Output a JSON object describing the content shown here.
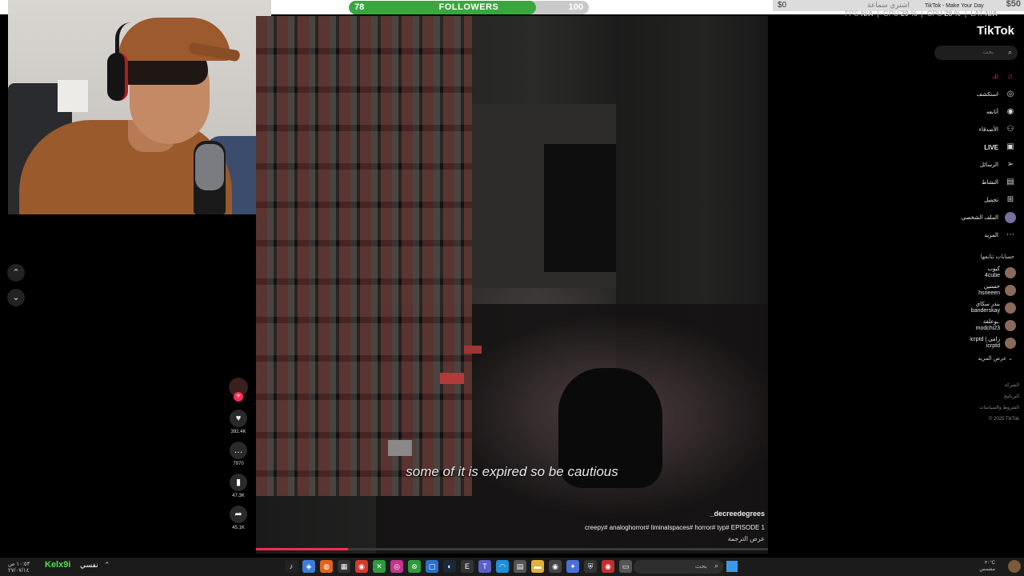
{
  "overlay": {
    "followers_label": "FOLLOWERS",
    "followers_current": "78",
    "followers_goal": "100",
    "followers_progress": 0.78,
    "donation_amount": "$0",
    "donation_text": "اشتري سماعة",
    "donation_goal": "$50",
    "window_title": "TikTok - Make Your Day"
  },
  "stats": {
    "fps_label": "FPS",
    "fps_value": "N/A",
    "gpu_label": "GPU",
    "gpu_value": "29 %",
    "cpu_label": "CPU",
    "cpu_value": "28 %",
    "lat_label": "LAT",
    "lat_value": "N/A"
  },
  "video": {
    "subtitle": "some of it is expired so be cautious",
    "author": "_decreedegrees",
    "caption": "creepy# analoghorror# liminalspaces# horror# typ# EPISODE 1",
    "translate": "عرض الترجمة",
    "progress": 0.18
  },
  "actions": {
    "plus": "+",
    "likes": "392.4K",
    "comments": "7970",
    "saves": "47.3K",
    "shares": "45.1K",
    "icons": [
      "heart-icon",
      "comment-icon",
      "bookmark-icon",
      "share-icon"
    ]
  },
  "nav_buttons": {
    "up": "⌃",
    "down": "⌄"
  },
  "tiktok": {
    "logo": "TikTok",
    "search_placeholder": "بحث",
    "nav": [
      {
        "label": "لك",
        "icon": "⌂",
        "active": true
      },
      {
        "label": "استكشف",
        "icon": "◎",
        "active": false
      },
      {
        "label": "أتابعه",
        "icon": "◉",
        "active": false
      },
      {
        "label": "الأصدقاء",
        "icon": "⚇",
        "active": false
      },
      {
        "label": "LIVE",
        "icon": "▣",
        "active": false
      },
      {
        "label": "الرسائل",
        "icon": "➢",
        "active": false
      },
      {
        "label": "النشاط",
        "icon": "▤",
        "active": false
      },
      {
        "label": "تحميل",
        "icon": "⊞",
        "active": false
      },
      {
        "label": "الملف الشخصي",
        "icon": "",
        "active": false
      },
      {
        "label": "المزيد",
        "icon": "⋯",
        "active": false
      }
    ],
    "following_title": "حسابات تتابعها",
    "following": [
      {
        "name": "كيوب",
        "handle": "4cube"
      },
      {
        "name": "حسنين",
        "handle": "hsneeen"
      },
      {
        "name": "بندر سكاي",
        "handle": "banderskay"
      },
      {
        "name": "بوعلقة.",
        "handle": "modchi23"
      },
      {
        "name": "icrptd | زامي",
        "handle": "icrptd"
      }
    ],
    "see_more": "عرض المزيد",
    "footer": [
      "الشركة",
      "البرنامج",
      "الشروط والسياسات",
      "© 2025 TikTok"
    ]
  },
  "taskbar": {
    "time": "١٠:٥٣ ص",
    "date": "٢٧/٠٧/١٤",
    "username": "Kelx9i",
    "username_suffix": "نفسي",
    "search_placeholder": "بحث",
    "weather_temp": "٣٠°C",
    "weather_desc": "مشمس",
    "apps": [
      {
        "name": "tiktok-app-icon",
        "glyph": "♪",
        "color": "#222"
      },
      {
        "name": "browser-icon",
        "glyph": "◈",
        "color": "#3b7dd8"
      },
      {
        "name": "firefox-icon",
        "glyph": "◍",
        "color": "#e2621b"
      },
      {
        "name": "cpu-monitor-icon",
        "glyph": "▦",
        "color": "#333"
      },
      {
        "name": "chrome-icon",
        "glyph": "◉",
        "color": "#d33b2c"
      },
      {
        "name": "xbox-icon",
        "glyph": "✕",
        "color": "#2e9a3e"
      },
      {
        "name": "instagram-icon",
        "glyph": "◎",
        "color": "#c1358a"
      },
      {
        "name": "app-xbox-icon",
        "glyph": "⊗",
        "color": "#2e9a3e"
      },
      {
        "name": "store-icon",
        "glyph": "▢",
        "color": "#2b6fc9"
      },
      {
        "name": "steam-icon",
        "glyph": "◐",
        "color": "#1b2838"
      },
      {
        "name": "epic-icon",
        "glyph": "E",
        "color": "#333"
      },
      {
        "name": "teams-icon",
        "glyph": "T",
        "color": "#5b5fc7"
      },
      {
        "name": "edge-icon",
        "glyph": "◠",
        "color": "#1f8fd8"
      },
      {
        "name": "widgets-icon",
        "glyph": "▤",
        "color": "#555"
      },
      {
        "name": "folder-icon",
        "glyph": "▬",
        "color": "#e0b23a"
      },
      {
        "name": "obs-icon",
        "glyph": "◉",
        "color": "#444"
      },
      {
        "name": "copilot-icon",
        "glyph": "✦",
        "color": "#4a6fd8"
      },
      {
        "name": "shield-app-icon",
        "glyph": "⛨",
        "color": "#333"
      },
      {
        "name": "record-icon",
        "glyph": "◉",
        "color": "#c03030"
      },
      {
        "name": "desktop-icon",
        "glyph": "▭",
        "color": "#555"
      }
    ]
  }
}
